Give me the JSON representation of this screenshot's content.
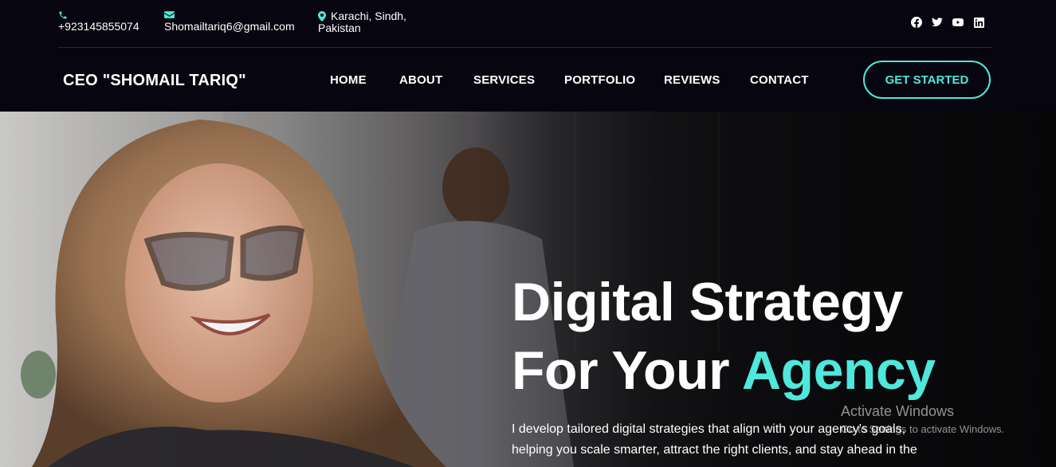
{
  "topbar": {
    "phone": "+923145855074",
    "email": "Shomailtariq6@gmail.com",
    "location_line1": "Karachi, Sindh,",
    "location_line2": "Pakistan",
    "socials": [
      "facebook-icon",
      "twitter-icon",
      "youtube-icon",
      "linkedin-icon"
    ]
  },
  "nav": {
    "brand": "CEO \"SHOMAIL TARIQ\"",
    "items": [
      "HOME",
      "ABOUT",
      "SERVICES",
      "PORTFOLIO",
      "REVIEWS",
      "CONTACT"
    ],
    "cta": "GET STARTED"
  },
  "hero": {
    "title_line1": "Digital Strategy",
    "title_line2_prefix": "For Your ",
    "title_accent": "Agency",
    "description_line1": "I develop tailored digital strategies that align with your agency's goals,",
    "description_line2": "helping you scale smarter, attract the right clients, and stay ahead in the"
  },
  "watermark": {
    "line1": "Activate Windows",
    "line2": "Go to Settings to activate Windows."
  },
  "colors": {
    "background": "#07050f",
    "accent": "#4ee8dc",
    "text": "#ffffff"
  }
}
